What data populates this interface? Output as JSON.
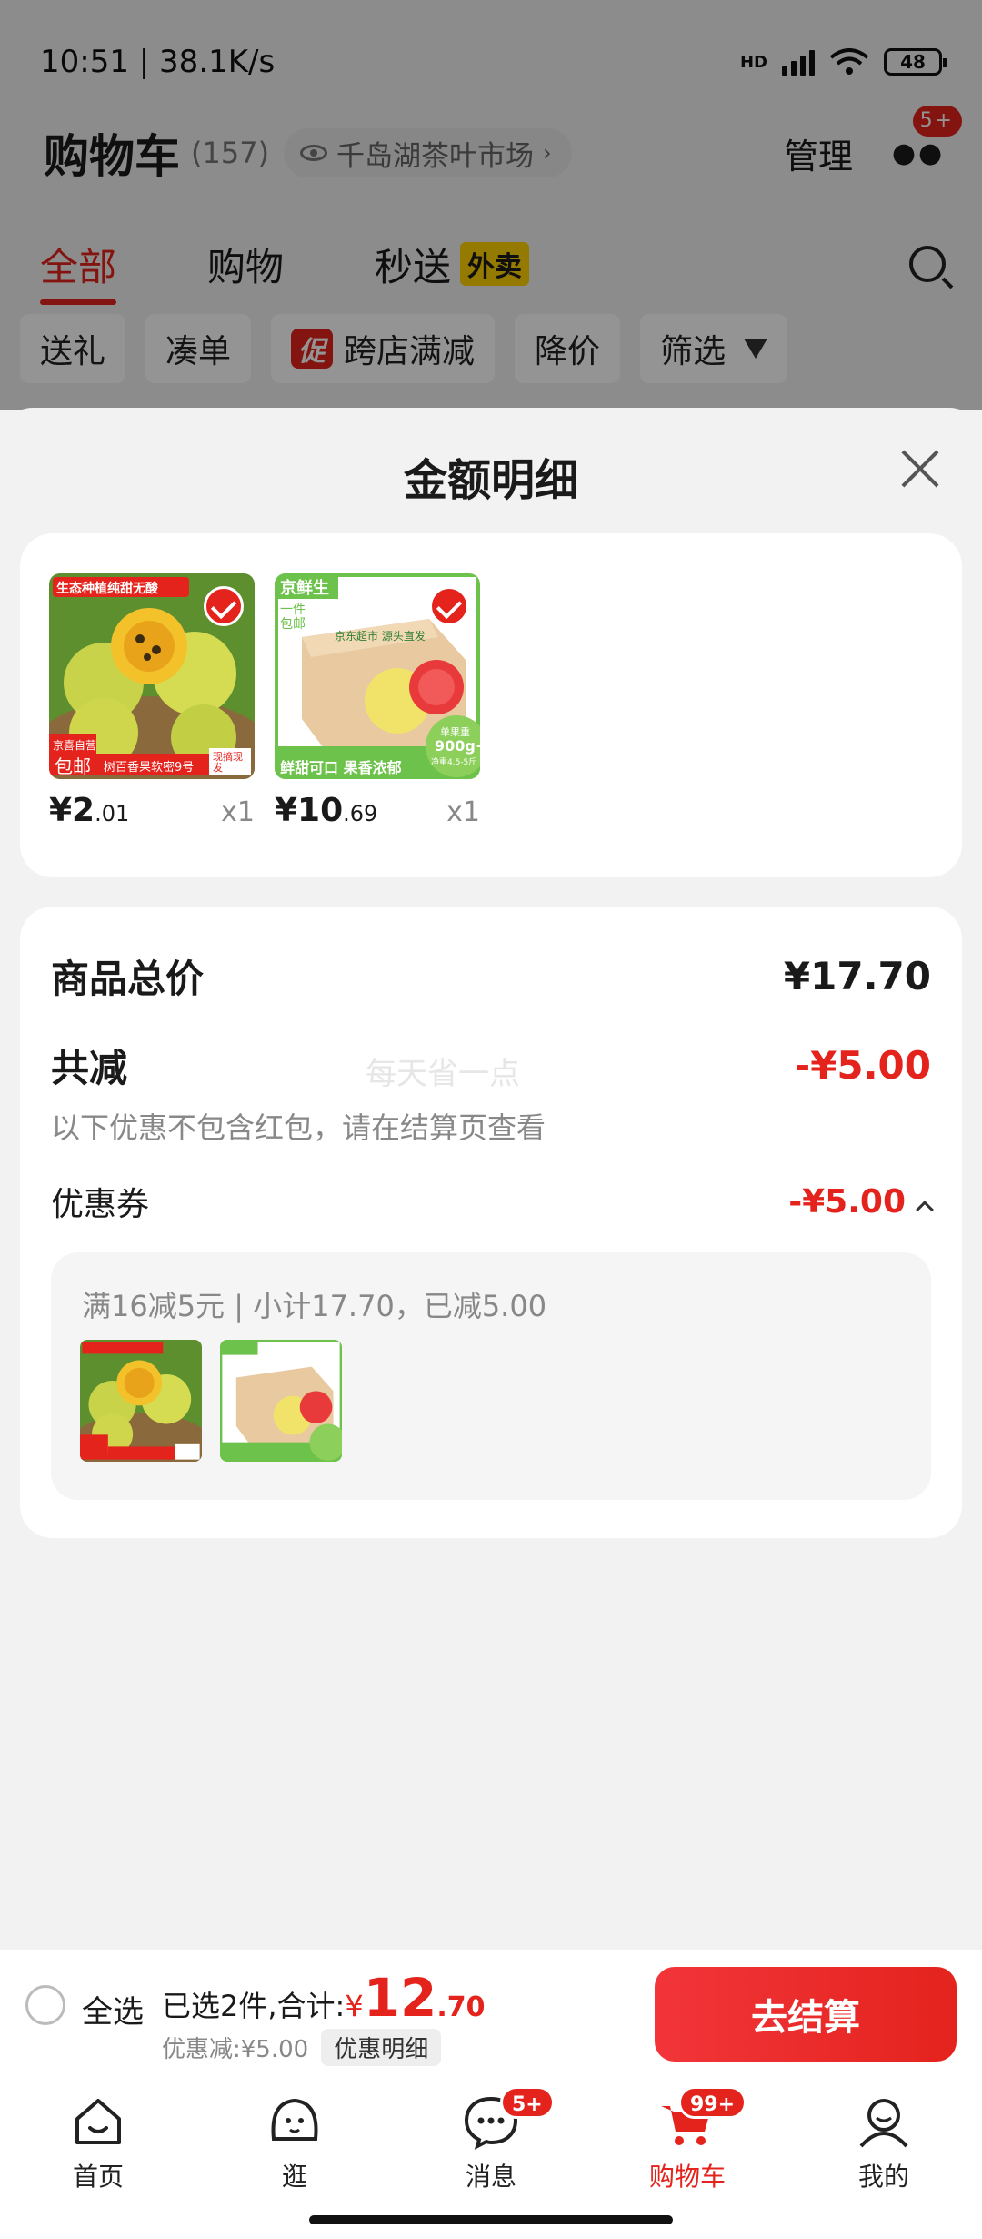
{
  "status_bar": {
    "time": "10:51 | 38.1K/s",
    "network": "HD",
    "battery": "48"
  },
  "header": {
    "title": "购物车",
    "count": "(157)",
    "store": "千岛湖茶叶市场",
    "manage": "管理",
    "more_badge": "5+"
  },
  "tabs": [
    {
      "label": "全部",
      "active": true
    },
    {
      "label": "购物"
    },
    {
      "label": "秒送",
      "tag": "外卖"
    }
  ],
  "filters": {
    "gift": "送礼",
    "combine": "凑单",
    "promo_tag": "促",
    "cross_store": "跨店满减",
    "price_drop": "降价",
    "filter": "筛选"
  },
  "sheet": {
    "title": "金额明细",
    "items": [
      {
        "price_int": "¥2",
        "price_dec": ".01",
        "qty": "x1"
      },
      {
        "price_int": "¥10",
        "price_dec": ".69",
        "qty": "x1"
      }
    ],
    "item1_labels": {
      "top": "生态种植纯甜无酸",
      "badge_top": "京喜自营",
      "badge": "包邮",
      "name": "树百香果软密9号",
      "tag": "现摘现发"
    },
    "item2_labels": {
      "brand": "京鲜生",
      "ship": "一件包邮",
      "box": "京东超市 源头直发",
      "weight": "900g+",
      "weight_label": "单果重",
      "spec": "净重4.5-5斤",
      "slogan": "鲜甜可口 果香浓郁"
    },
    "total_label": "商品总价",
    "total_value": "¥17.70",
    "reduce_label": "共减",
    "reduce_value": "-¥5.00",
    "watermark": "每天省一点",
    "note": "以下优惠不包含红包，请在结算页查看",
    "coupon_label": "优惠券",
    "coupon_value": "-¥5.00",
    "coupon_detail": "满16减5元 | 小计17.70，已减5.00"
  },
  "checkout": {
    "select_all": "全选",
    "selected_text": "已选2件,合计:",
    "currency": "¥",
    "total_int": "12",
    "total_dec": ".70",
    "discount_text": "优惠减:¥5.00",
    "detail_button": "优惠明细",
    "pay_button": "去结算"
  },
  "tabbar": [
    {
      "label": "首页",
      "icon": "home-icon"
    },
    {
      "label": "逛",
      "icon": "explore-icon"
    },
    {
      "label": "消息",
      "icon": "message-icon",
      "badge": "5+"
    },
    {
      "label": "购物车",
      "icon": "cart-icon",
      "badge": "99+",
      "active": true
    },
    {
      "label": "我的",
      "icon": "profile-icon"
    }
  ],
  "colors": {
    "accent": "#e4231d",
    "takeout_tag": "#ffd300",
    "fresh_green": "#6cc24a"
  }
}
